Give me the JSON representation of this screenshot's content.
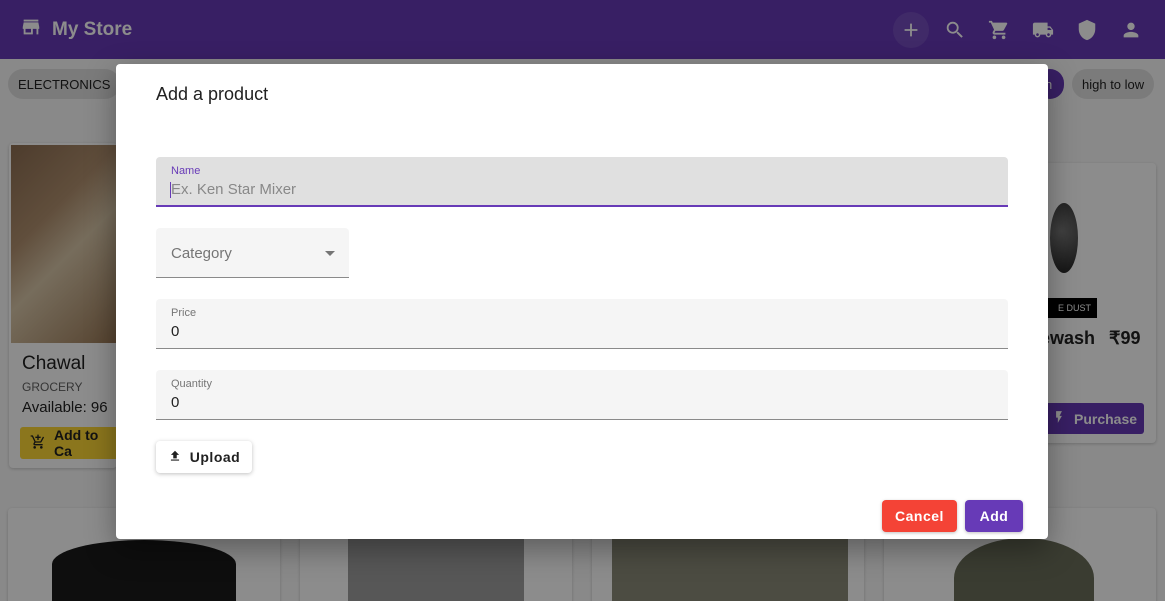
{
  "app": {
    "title": "My Store"
  },
  "appbar": {
    "icons": [
      "add-icon",
      "search-icon",
      "cart-icon",
      "truck-icon",
      "shield-icon",
      "account-icon"
    ]
  },
  "filters": {
    "category_chip": "ELECTRONICS",
    "sort_chip": "high to low",
    "selected_chip_partial": "n"
  },
  "cards": [
    {
      "title": "Chawal",
      "category": "GROCERY",
      "available": "Available: 96",
      "button": "Add to Ca"
    },
    {
      "title": "ewash",
      "price": "₹99",
      "badge": "E DUST",
      "button": "Purchase"
    }
  ],
  "dialog": {
    "title": "Add a product",
    "name": {
      "label": "Name",
      "placeholder": "Ex. Ken Star Mixer",
      "value": ""
    },
    "category": {
      "label": "Category"
    },
    "price": {
      "label": "Price",
      "value": "0"
    },
    "quantity": {
      "label": "Quantity",
      "value": "0"
    },
    "upload_label": "Upload",
    "cancel_label": "Cancel",
    "add_label": "Add"
  },
  "colors": {
    "primary": "#673ab7",
    "danger": "#f44336",
    "accent": "#fdd835"
  }
}
